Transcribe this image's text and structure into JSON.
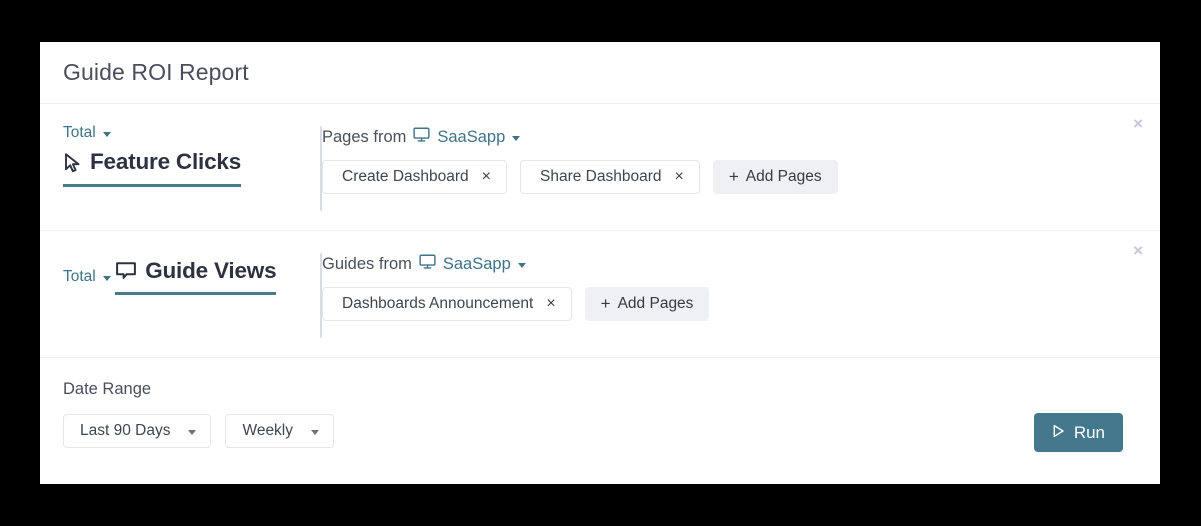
{
  "card": {
    "title": "Guide ROI Report"
  },
  "metric_rows": [
    {
      "aggregation": "Total",
      "metric_label": "Feature Clicks",
      "metric_icon": "cursor-pointer-icon",
      "source_prefix": "Pages from",
      "source_app": "SaaSapp",
      "source_app_icon": "monitor-icon",
      "chips": [
        {
          "label": "Create Dashboard",
          "remove": "×"
        },
        {
          "label": "Share Dashboard",
          "remove": "×"
        }
      ],
      "add_button": "Add Pages",
      "add_icon": "plus-icon",
      "close_icon": "×"
    },
    {
      "aggregation": "Total",
      "metric_label": "Guide Views",
      "metric_icon": "speech-bubble-icon",
      "source_prefix": "Guides from",
      "source_app": "SaaSapp",
      "source_app_icon": "monitor-icon",
      "chips": [
        {
          "label": "Dashboards Announcement",
          "remove": "×"
        }
      ],
      "add_button": "Add Pages",
      "add_icon": "plus-icon",
      "close_icon": "×"
    }
  ],
  "footer": {
    "date_range_label": "Date Range",
    "range_value": "Last 90 Days",
    "interval_value": "Weekly",
    "run_label": "Run",
    "run_icon": "play-icon"
  },
  "colors": {
    "accent_teal": "#3f7389",
    "underline_teal": "#4a7b8c",
    "run_button": "#44788c",
    "chip_border": "#e3e6ea",
    "add_button_bg": "#eef0f4",
    "close_icon": "#c3c7d6",
    "title_text": "#4a4f5c",
    "metric_text": "#2e3240"
  }
}
